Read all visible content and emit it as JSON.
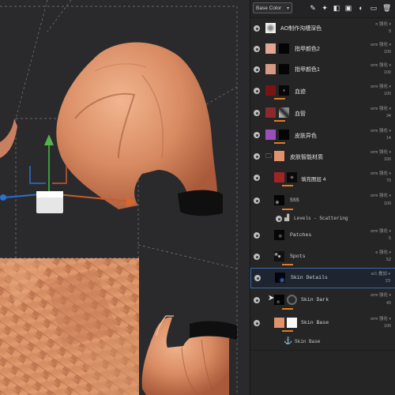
{
  "toolbar": {
    "channel_label": "Base Color",
    "icons": [
      "paint-brush-icon",
      "smart-material-icon",
      "add-fill-layer-icon",
      "add-paint-layer-icon",
      "add-mask-icon",
      "add-folder-icon",
      "delete-layer-icon"
    ]
  },
  "layers": [
    {
      "name": "AO制作沟槽深色",
      "blend": "n 强化",
      "opacity": "9"
    },
    {
      "name": "指甲颜色2",
      "blend": "orm 强化",
      "opacity": "100"
    },
    {
      "name": "指甲颜色1",
      "blend": "orm 强化",
      "opacity": "100"
    },
    {
      "name": "血迹",
      "blend": "orm 强化",
      "opacity": "100"
    },
    {
      "name": "血管",
      "blend": "orm 强化",
      "opacity": "34"
    },
    {
      "name": "皮肤异色",
      "blend": "orm 强化",
      "opacity": "14"
    },
    {
      "name": "皮肤智能材质",
      "blend": "orm 强化",
      "opacity": "100"
    },
    {
      "name": "填充图层 4",
      "blend": "orm 强化",
      "opacity": "70"
    },
    {
      "name": "SSS",
      "blend": "orm 强化",
      "opacity": "100"
    },
    {
      "name": "Levels - Scattering",
      "blend": "",
      "opacity": ""
    },
    {
      "name": "Patches",
      "blend": "orm 强化",
      "opacity": "5"
    },
    {
      "name": "Spots",
      "blend": "e 强化",
      "opacity": "52"
    },
    {
      "name": "Skin Details",
      "blend": "ur1 叠加",
      "opacity": "23"
    },
    {
      "name": "Skin Dark",
      "blend": "orm 强化",
      "opacity": "40"
    },
    {
      "name": "Skin Base",
      "blend": "orm 强化",
      "opacity": "100"
    },
    {
      "name": "Skin Base",
      "blend": "",
      "opacity": ""
    }
  ],
  "colors": {
    "panel_bg": "#252526",
    "viewport_bg": "#2a2a2c",
    "accent_orange": "#e07b20",
    "selection_blue": "#3c6aa3",
    "skin": "#e0926a"
  }
}
